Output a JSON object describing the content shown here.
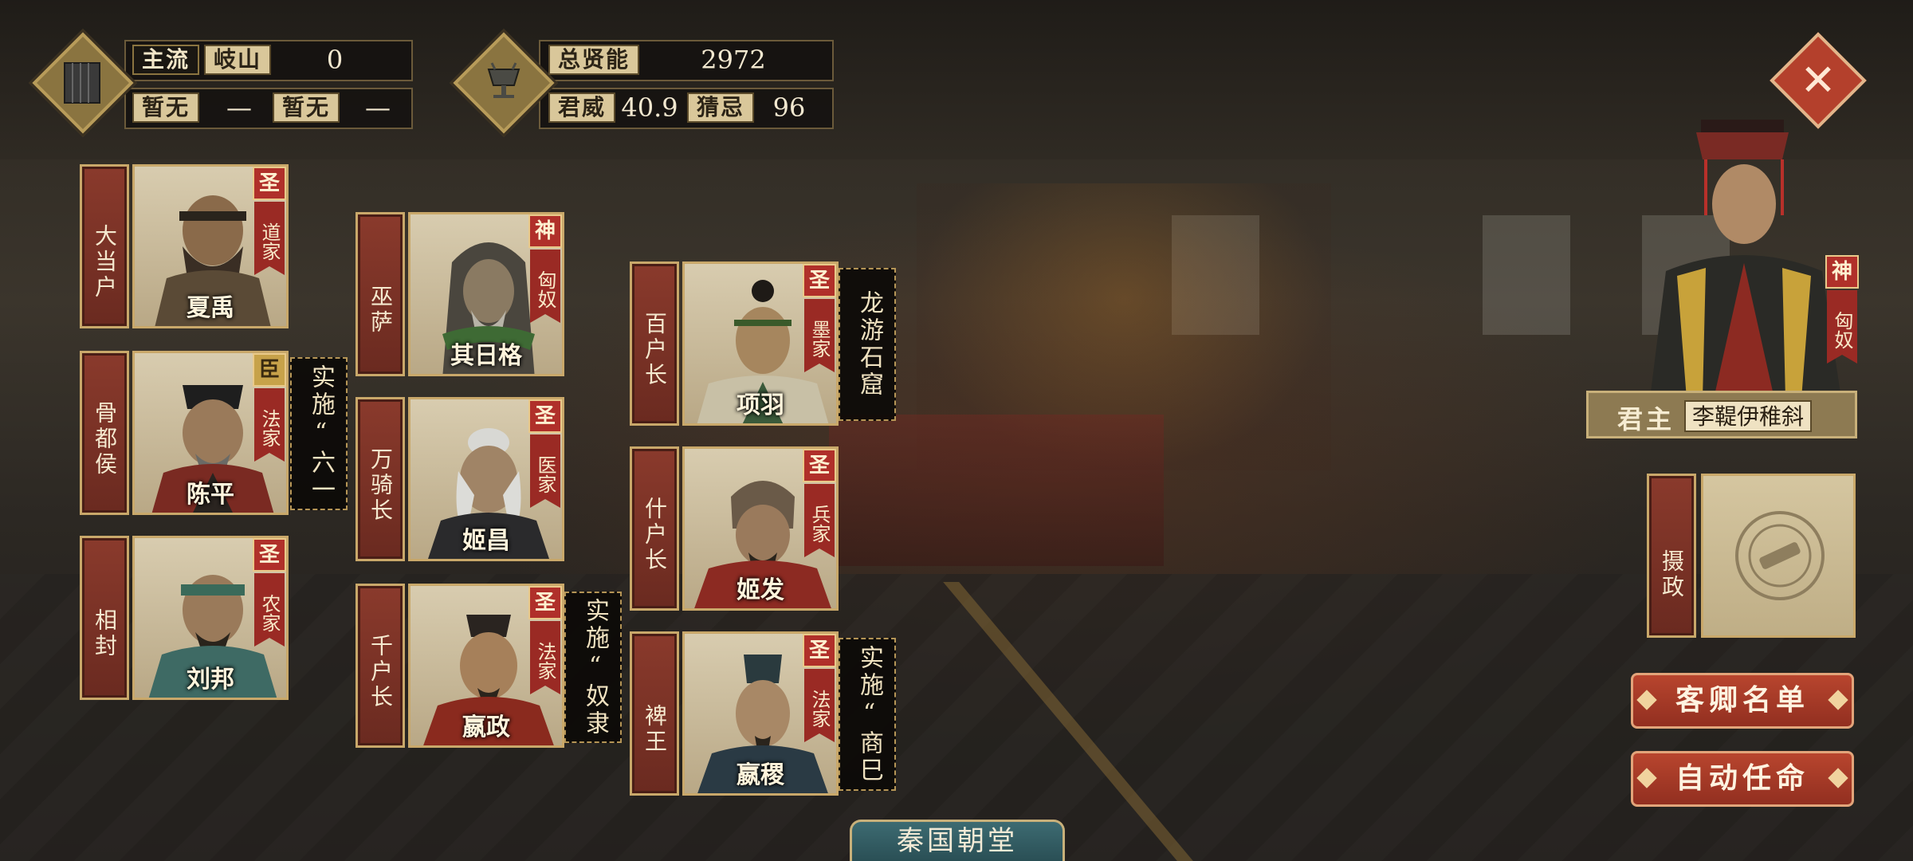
{
  "top_left": {
    "mainstream_label": "主流",
    "mainstream_value": "岐山",
    "mainstream_count": "0",
    "slot_a_label": "暂无",
    "slot_a_value": "—",
    "slot_b_label": "暂无",
    "slot_b_value": "—"
  },
  "top_center": {
    "total_talent_label": "总贤能",
    "total_talent_value": "2972",
    "prestige_label": "君威",
    "prestige_value": "40.9",
    "suspicion_label": "猜忌",
    "suspicion_value": "96"
  },
  "officials": [
    {
      "rank": "大当户",
      "name": "夏禹",
      "grade": "圣",
      "school": "道家"
    },
    {
      "rank": "骨都侯",
      "name": "陈平",
      "grade": "臣",
      "school": "法家",
      "policy": "实施“六一"
    },
    {
      "rank": "相封",
      "name": "刘邦",
      "grade": "圣",
      "school": "农家"
    },
    {
      "rank": "巫萨",
      "name": "其日格",
      "grade": "神",
      "school": "匈奴"
    },
    {
      "rank": "万骑长",
      "name": "姬昌",
      "grade": "圣",
      "school": "医家"
    },
    {
      "rank": "千户长",
      "name": "嬴政",
      "grade": "圣",
      "school": "法家",
      "policy": "实施“奴隶"
    },
    {
      "rank": "百户长",
      "name": "项羽",
      "grade": "圣",
      "school": "墨家",
      "policy": "龙游石窟"
    },
    {
      "rank": "什户长",
      "name": "姬发",
      "grade": "圣",
      "school": "兵家"
    },
    {
      "rank": "裨王",
      "name": "嬴稷",
      "grade": "圣",
      "school": "法家",
      "policy": "实施“商巳"
    }
  ],
  "monarch": {
    "grade": "神",
    "school": "匈奴",
    "title": "君主",
    "name": "李鞮伊稚斜"
  },
  "regent": {
    "label": "摄政"
  },
  "buttons": {
    "guest_list": "客卿名单",
    "auto_appoint": "自动任命",
    "close": "✕"
  },
  "court_title": "秦国朝堂",
  "colors": {
    "accent_red": "#9a2a24",
    "gold_border": "#c9a86a",
    "button_red": "#b8452e",
    "title_teal": "#3d6b72"
  }
}
